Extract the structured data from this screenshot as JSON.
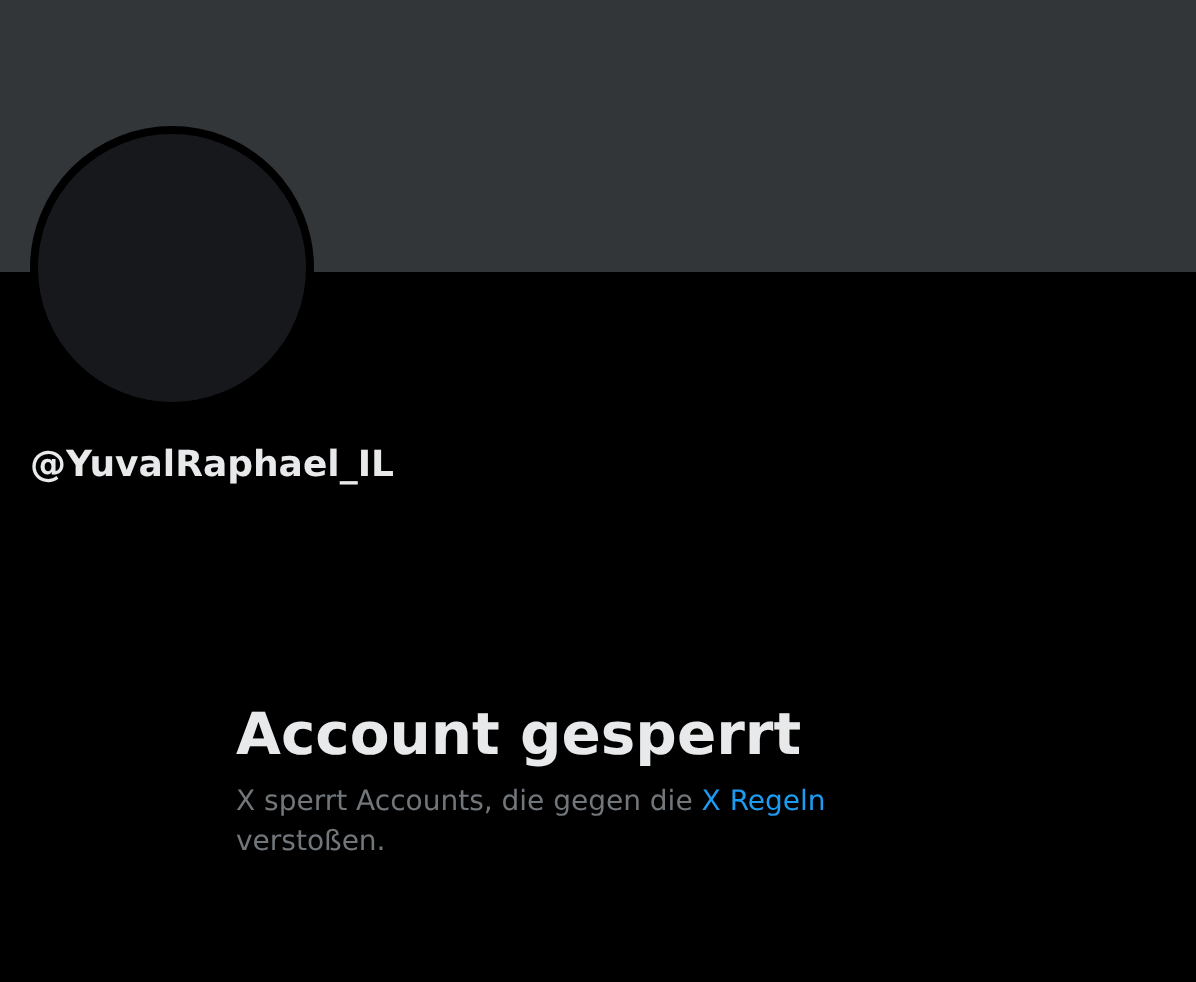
{
  "profile": {
    "handle": "@YuvalRaphael_IL"
  },
  "notice": {
    "title": "Account gesperrt",
    "text": "X sperrt Accounts, die gegen die",
    "link": "X Regeln",
    "text_end": "verstoßen."
  }
}
